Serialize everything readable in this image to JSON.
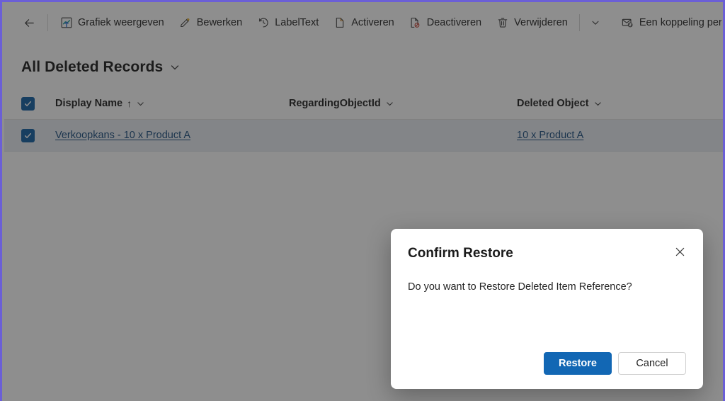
{
  "window": {
    "focus_border_color": "#6b5fd6",
    "background": "#ffffff"
  },
  "commandbar": {
    "back_icon": "back-arrow-icon",
    "items": [
      {
        "icon": "chart-icon",
        "label": "Grafiek weergeven"
      },
      {
        "icon": "pencil-icon",
        "label": "Bewerken"
      },
      {
        "icon": "history-icon",
        "label": "LabelText"
      },
      {
        "icon": "document-icon",
        "label": "Activeren"
      },
      {
        "icon": "document-block-icon",
        "label": "Deactiveren"
      },
      {
        "icon": "trash-icon",
        "label": "Verwijderen"
      }
    ],
    "overflow_caret": "chevron-down-icon",
    "email_link_item": {
      "icon": "email-link-icon",
      "label": "Een koppeling per e-..."
    }
  },
  "view": {
    "title": "All Deleted Records",
    "title_caret": "chevron-down-icon"
  },
  "grid": {
    "select_all_checked": true,
    "columns": [
      {
        "label": "Display Name",
        "sorted": true,
        "sort_arrow": "↑",
        "caret": "chevron-down-icon"
      },
      {
        "label": "RegardingObjectId",
        "sorted": false,
        "sort_arrow": "",
        "caret": "chevron-down-icon"
      },
      {
        "label": "Deleted Object",
        "sorted": false,
        "sort_arrow": "",
        "caret": "chevron-down-icon"
      }
    ],
    "rows": [
      {
        "selected": true,
        "display_name": "Verkoopkans - 10 x Product A",
        "regarding_object_id": "",
        "deleted_object": "10 x Product A"
      }
    ]
  },
  "dialog": {
    "title": "Confirm Restore",
    "close_icon": "close-icon",
    "message": "Do you want to Restore Deleted Item Reference?",
    "primary_button": "Restore",
    "secondary_button": "Cancel",
    "primary_color": "#1267b4"
  }
}
